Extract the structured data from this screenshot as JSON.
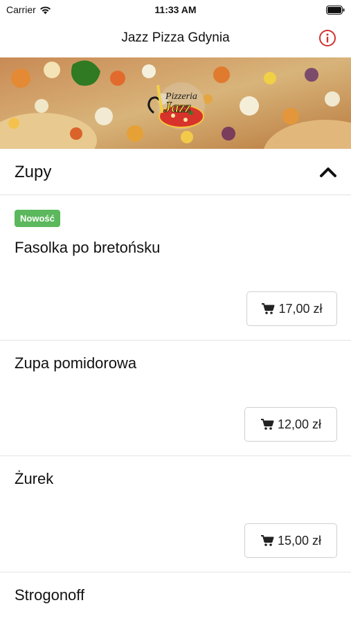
{
  "status_bar": {
    "carrier": "Carrier",
    "time": "11:33 AM"
  },
  "nav": {
    "title": "Jazz Pizza Gdynia",
    "info_icon": "info-circle-icon"
  },
  "banner": {
    "logo_text_top": "Pizzeria",
    "logo_text_main": "Jazz"
  },
  "section": {
    "title": "Zupy",
    "expanded": true
  },
  "items": [
    {
      "badge": "Nowość",
      "name": "Fasolka po bretońsku",
      "price": "17,00 zł"
    },
    {
      "name": "Zupa pomidorowa",
      "price": "12,00 zł"
    },
    {
      "name": "Żurek",
      "price": "15,00 zł"
    },
    {
      "name": "Strogonoff"
    }
  ],
  "colors": {
    "accent_red": "#d0312d",
    "badge_green": "#5cb85c"
  }
}
